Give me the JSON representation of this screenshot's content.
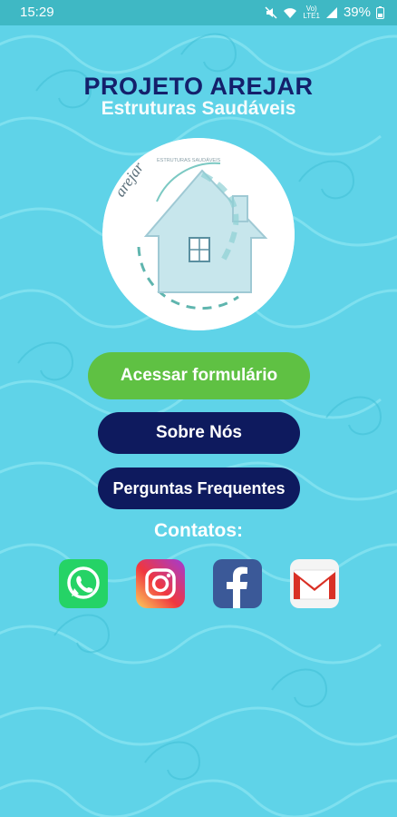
{
  "status_bar": {
    "time": "15:29",
    "lte_top": "Vo)",
    "lte_bottom": "LTE1",
    "battery": "39%"
  },
  "app": {
    "title": "PROJETO AREJAR",
    "subtitle": "Estruturas Saudáveis"
  },
  "logo": {
    "brand_text": "arejar",
    "tagline": "ESTRUTURAS SAUDÁVEIS"
  },
  "buttons": {
    "form": "Acessar formulário",
    "about": "Sobre Nós",
    "faq": "Perguntas Frequentes"
  },
  "contacts": {
    "label": "Contatos:",
    "items": [
      {
        "icon": "whatsapp-icon",
        "color": "#25d366"
      },
      {
        "icon": "instagram-icon",
        "color": "#d6249f"
      },
      {
        "icon": "facebook-icon",
        "color": "#3b5998"
      },
      {
        "icon": "gmail-icon",
        "color": "#d93025"
      }
    ]
  },
  "colors": {
    "background": "#5fd3e8",
    "title": "#14206b",
    "primary_button": "#5fc143",
    "secondary_button": "#0e1a5e",
    "status_bar": "#3fb8c4"
  }
}
